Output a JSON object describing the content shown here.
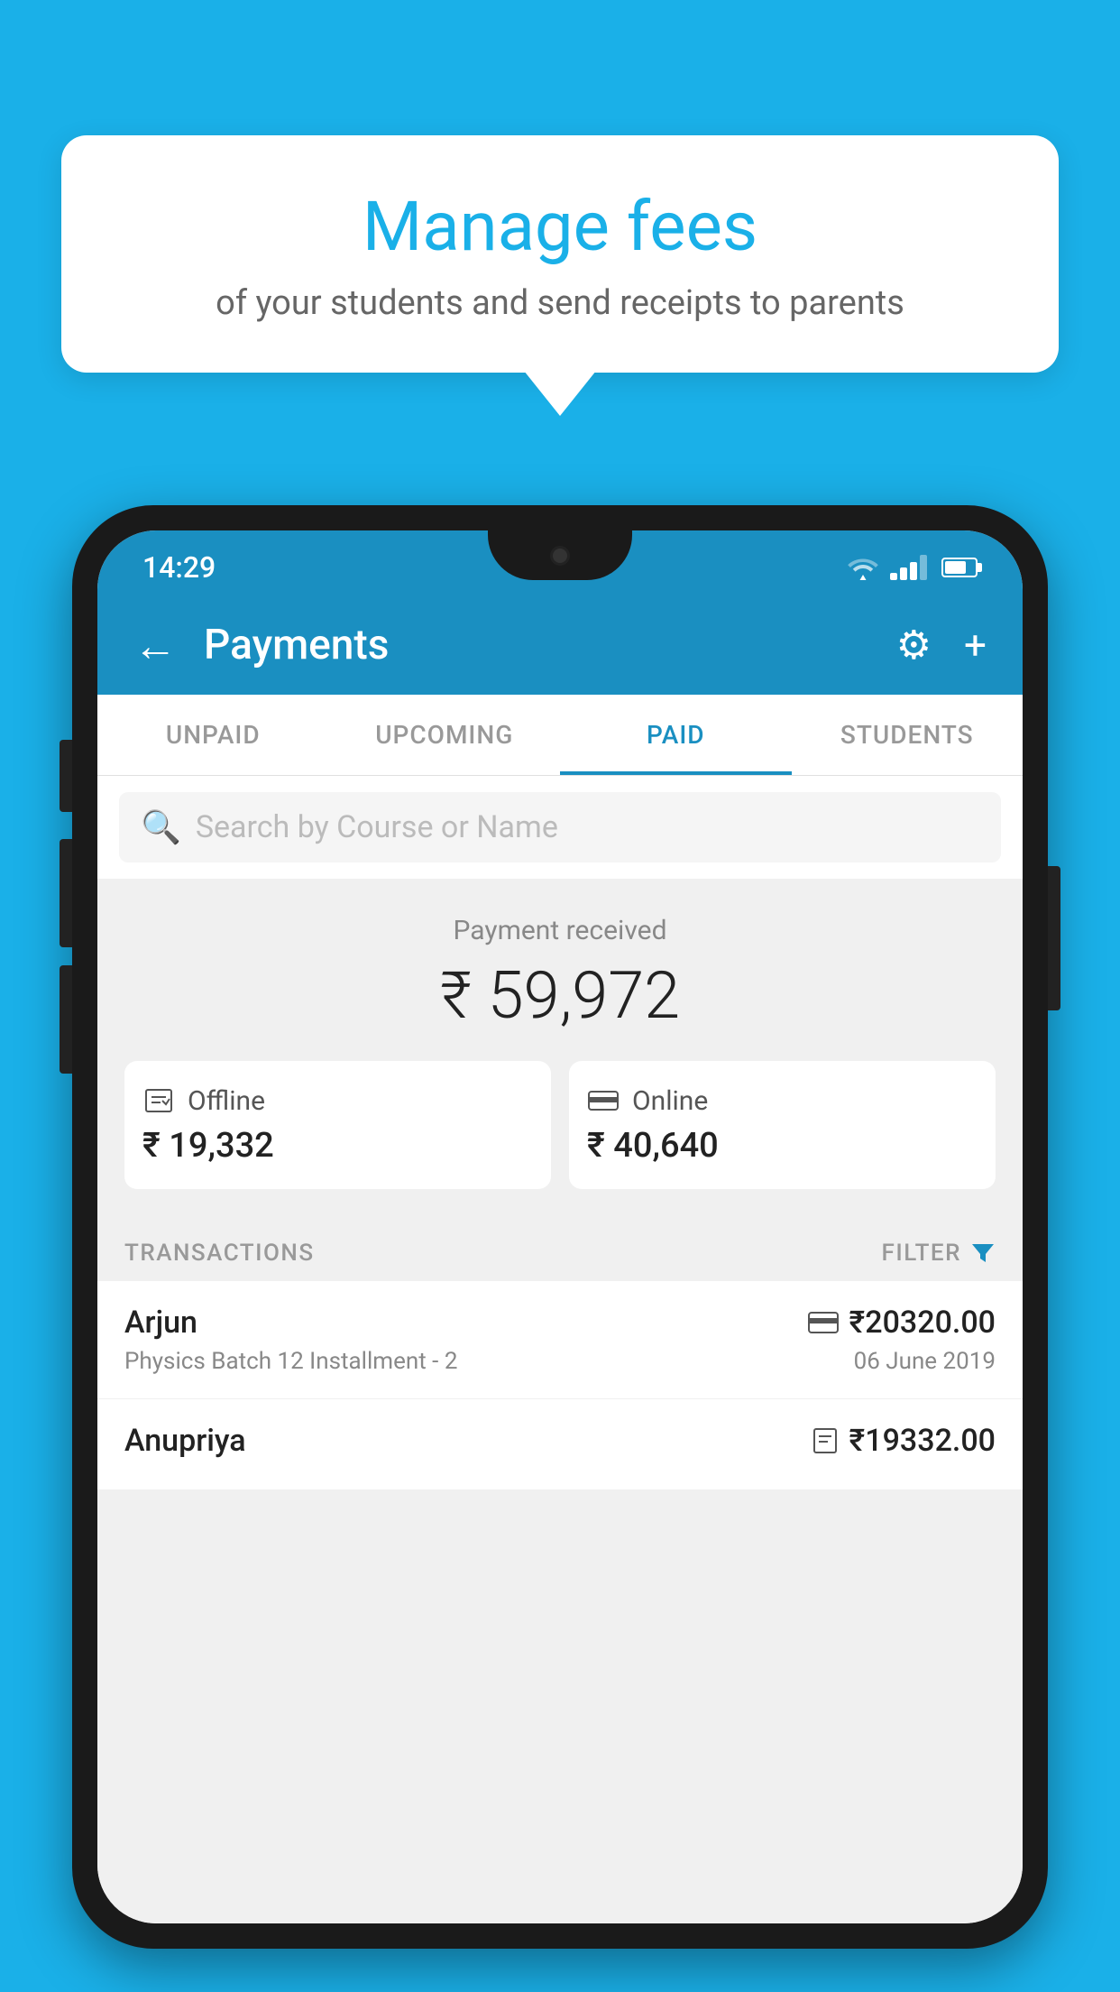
{
  "background_color": "#1ab0e8",
  "speech_bubble": {
    "title": "Manage fees",
    "subtitle": "of your students and send receipts to parents"
  },
  "status_bar": {
    "time": "14:29"
  },
  "app_bar": {
    "title": "Payments",
    "back_label": "←",
    "settings_label": "⚙",
    "add_label": "+"
  },
  "tabs": [
    {
      "label": "UNPAID",
      "active": false
    },
    {
      "label": "UPCOMING",
      "active": false
    },
    {
      "label": "PAID",
      "active": true
    },
    {
      "label": "STUDENTS",
      "active": false
    }
  ],
  "search": {
    "placeholder": "Search by Course or Name"
  },
  "payment_summary": {
    "label": "Payment received",
    "amount": "₹ 59,972",
    "offline": {
      "label": "Offline",
      "amount": "₹ 19,332"
    },
    "online": {
      "label": "Online",
      "amount": "₹ 40,640"
    }
  },
  "transactions_section": {
    "label": "TRANSACTIONS",
    "filter_label": "FILTER"
  },
  "transactions": [
    {
      "name": "Arjun",
      "course": "Physics Batch 12 Installment - 2",
      "amount": "₹20320.00",
      "date": "06 June 2019",
      "type": "online"
    },
    {
      "name": "Anupriya",
      "course": "",
      "amount": "₹19332.00",
      "date": "",
      "type": "offline"
    }
  ]
}
